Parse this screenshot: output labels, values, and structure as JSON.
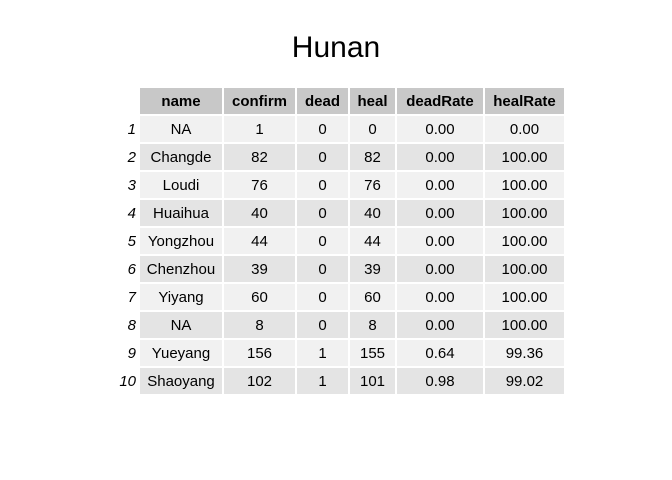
{
  "chart_data": {
    "type": "table",
    "title": "Hunan",
    "columns": [
      "name",
      "confirm",
      "dead",
      "heal",
      "deadRate",
      "healRate"
    ],
    "row_names": [
      "1",
      "2",
      "3",
      "4",
      "5",
      "6",
      "7",
      "8",
      "9",
      "10"
    ],
    "rows": [
      [
        "NA",
        "1",
        "0",
        "0",
        "0.00",
        "0.00"
      ],
      [
        "Changde",
        "82",
        "0",
        "82",
        "0.00",
        "100.00"
      ],
      [
        "Loudi",
        "76",
        "0",
        "76",
        "0.00",
        "100.00"
      ],
      [
        "Huaihua",
        "40",
        "0",
        "40",
        "0.00",
        "100.00"
      ],
      [
        "Yongzhou",
        "44",
        "0",
        "44",
        "0.00",
        "100.00"
      ],
      [
        "Chenzhou",
        "39",
        "0",
        "39",
        "0.00",
        "100.00"
      ],
      [
        "Yiyang",
        "60",
        "0",
        "60",
        "0.00",
        "100.00"
      ],
      [
        "NA",
        "8",
        "0",
        "8",
        "0.00",
        "100.00"
      ],
      [
        "Yueyang",
        "156",
        "1",
        "155",
        "0.64",
        "99.36"
      ],
      [
        "Shaoyang",
        "102",
        "1",
        "101",
        "0.98",
        "99.02"
      ]
    ],
    "colors": {
      "header_fill": "#c8c8c8",
      "row_fill_odd": "#f1f1f1",
      "row_fill_even": "#e4e4e4"
    }
  }
}
